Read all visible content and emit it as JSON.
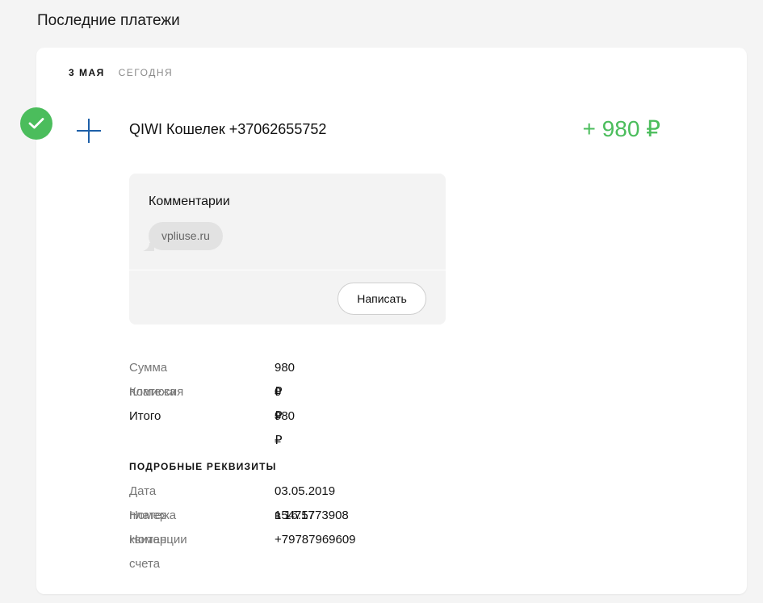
{
  "page": {
    "title": "Последние платежи"
  },
  "date_header": {
    "date": "3 мая",
    "relative": "сегодня"
  },
  "payment": {
    "title": "QIWI Кошелек +37062655752",
    "amount": "+ 980 ₽",
    "status_icon": "check-icon",
    "type_icon": "plus-icon",
    "colors": {
      "positive": "#4bbd5c",
      "icon_blue": "#1d5fa8"
    }
  },
  "comments": {
    "title": "Комментарии",
    "items": [
      "vpliuse.ru"
    ],
    "write_button": "Написать"
  },
  "summary": [
    {
      "label": "Сумма платежа",
      "value": "980 ₽"
    },
    {
      "label": "Комиссия",
      "value": "0 ₽"
    },
    {
      "label": "Итого",
      "value": "980 ₽"
    }
  ],
  "details": {
    "heading": "Подробные реквизиты",
    "rows": [
      {
        "label": "Дата платежа",
        "value": "03.05.2019 в 16:17"
      },
      {
        "label": "Номер квитанции",
        "value": "15475773908"
      },
      {
        "label": "Номер счета",
        "value": "+79787969609"
      }
    ]
  }
}
